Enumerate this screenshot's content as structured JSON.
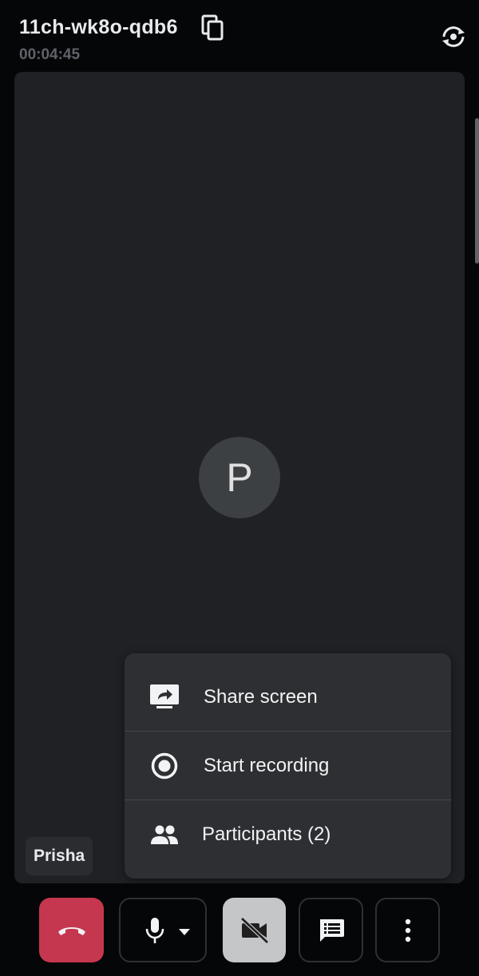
{
  "header": {
    "meeting_code": "11ch-wk8o-qdb6",
    "elapsed_time": "00:04:45",
    "copy_icon": "copy-icon",
    "switch_camera_icon": "switch-camera-icon"
  },
  "stage": {
    "avatar_initial": "P",
    "participant_name": "Prisha"
  },
  "menu": {
    "items": [
      {
        "label": "Share screen",
        "icon": "share-screen-icon"
      },
      {
        "label": "Start recording",
        "icon": "record-icon"
      },
      {
        "label": "Participants (2)",
        "icon": "participants-icon"
      }
    ]
  },
  "controls": {
    "end_call_icon": "end-call-icon",
    "mic_icon": "mic-icon",
    "mic_dropdown_icon": "caret-down-icon",
    "camera_icon": "camera-off-icon",
    "chat_icon": "chat-icon",
    "more_icon": "more-vert-icon"
  },
  "colors": {
    "background": "#050608",
    "stage": "#202124",
    "menu": "#2e2f32",
    "end_call": "#c5374f",
    "camera_off": "#c4c6c8",
    "timer": "#5f6368"
  }
}
